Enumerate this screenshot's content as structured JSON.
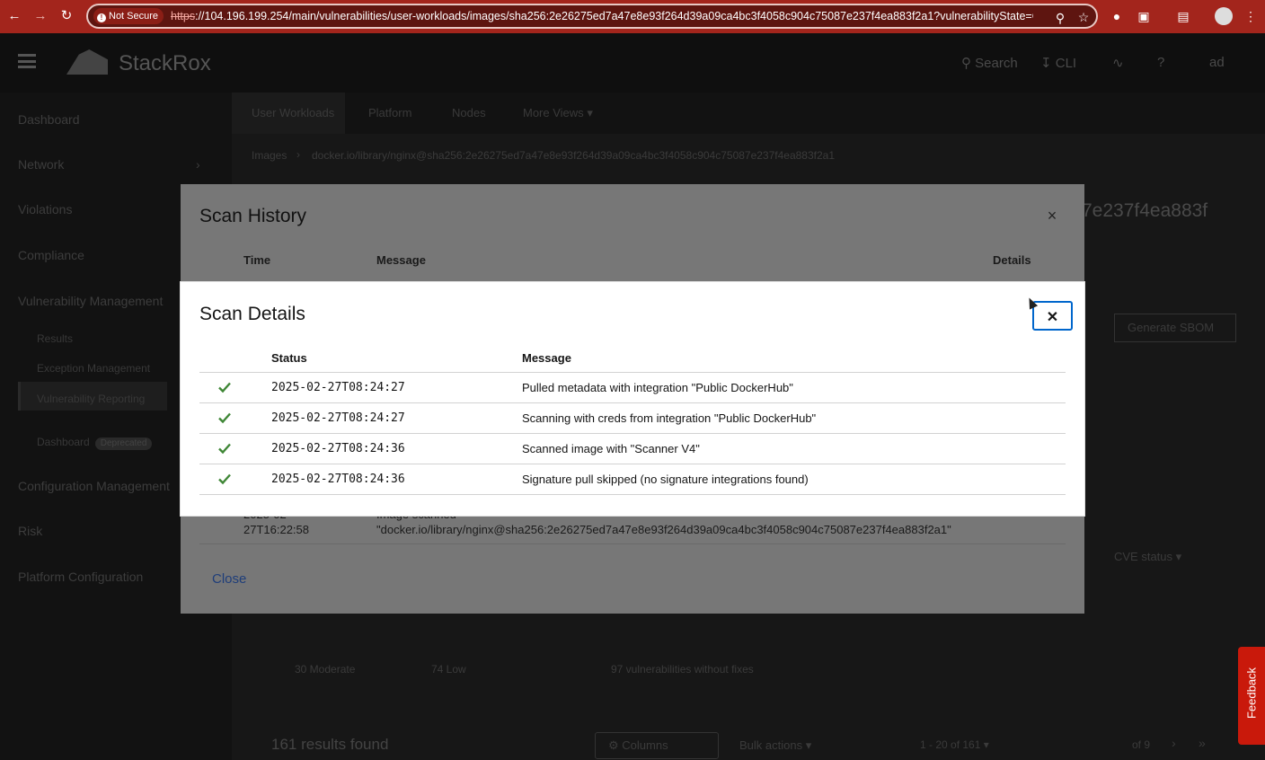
{
  "browser": {
    "security_badge": "Not Secure",
    "url_scheme": "https",
    "url_rest": "://104.196.199.254/main/vulnerabilities/user-workloads/images/sha256:2e26275ed7a47e8e93f264d39a09ca4bc3f4058c904c75087e237f4ea883f2a1?vulnerabilityState=O..."
  },
  "masthead": {
    "brand": "StackRox",
    "search_label": "Search",
    "cli_label": "CLI",
    "user_label": "ad"
  },
  "sidebar": {
    "items": [
      {
        "label": "Dashboard"
      },
      {
        "label": "Network"
      },
      {
        "label": "Violations"
      },
      {
        "label": "Compliance"
      },
      {
        "label": "Vulnerability Management"
      },
      {
        "label": "Configuration Management"
      },
      {
        "label": "Risk"
      },
      {
        "label": "Platform Configuration"
      }
    ],
    "sub_items": [
      {
        "label": "Results"
      },
      {
        "label": "Exception Management"
      },
      {
        "label": "Vulnerability Reporting"
      },
      {
        "label": "Dashboard"
      }
    ],
    "deprecated_badge": "Deprecated"
  },
  "tabs": [
    {
      "label": "User Workloads"
    },
    {
      "label": "Platform"
    },
    {
      "label": "Nodes"
    },
    {
      "label": "More Views"
    }
  ],
  "content": {
    "breadcrumb_root": "Images",
    "breadcrumb_current": "docker.io/library/nginx@sha256:2e26275ed7a47e8e93f264d39a09ca4bc3f4058c904c75087e237f4ea883f2a1",
    "title_fragment": "7e237f4ea883f",
    "generate_sbom_label": "Generate SBOM",
    "cve_status_label": "CVE status",
    "moderate_count": "30 Moderate",
    "low_count": "74 Low",
    "without_fixes": "97 vulnerabilities without fixes",
    "results_found": "161 results found",
    "columns_label": "Columns",
    "bulk_actions_label": "Bulk actions",
    "pagination_range": "1 - 20 of 161",
    "page_of": "of 9"
  },
  "scan_history": {
    "title": "Scan History",
    "headers": {
      "time": "Time",
      "message": "Message",
      "details": "Details"
    },
    "row": {
      "time_line1": "2025-02-",
      "time_line2": "27T16:22:58",
      "message_line1": "Image scanned",
      "message_line2": "\"docker.io/library/nginx@sha256:2e26275ed7a47e8e93f264d39a09ca4bc3f4058c904c75087e237f4ea883f2a1\""
    },
    "close_label": "Close"
  },
  "scan_details": {
    "title": "Scan Details",
    "headers": {
      "status": "Status",
      "message": "Message"
    },
    "rows": [
      {
        "time": "2025-02-27T08:24:27",
        "message": "Pulled metadata with integration \"Public DockerHub\""
      },
      {
        "time": "2025-02-27T08:24:27",
        "message": "Scanning with creds from integration \"Public DockerHub\""
      },
      {
        "time": "2025-02-27T08:24:36",
        "message": "Scanned image with \"Scanner V4\""
      },
      {
        "time": "2025-02-27T08:24:36",
        "message": "Signature pull skipped (no signature integrations found)"
      }
    ],
    "success_color": "#3e8635"
  },
  "feedback": {
    "label": "Feedback"
  }
}
